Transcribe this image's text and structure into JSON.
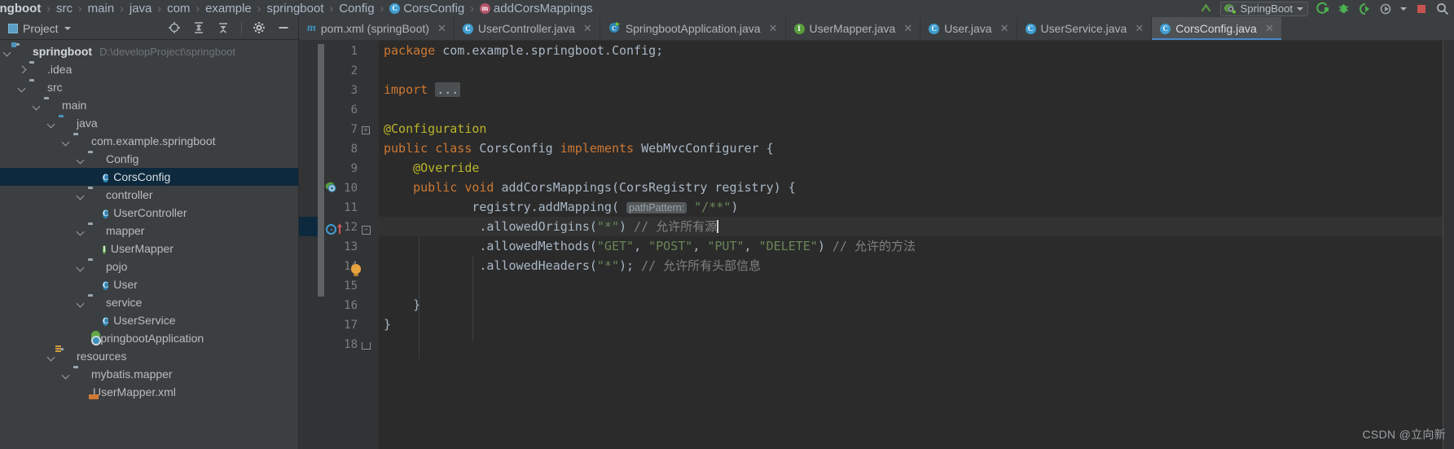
{
  "breadcrumb": {
    "items": [
      {
        "label": "springboot",
        "icon": "none",
        "bold": true
      },
      {
        "label": "src",
        "icon": "none",
        "bold": false
      },
      {
        "label": "main",
        "icon": "none",
        "bold": false
      },
      {
        "label": "java",
        "icon": "none",
        "bold": false
      },
      {
        "label": "com",
        "icon": "none",
        "bold": false
      },
      {
        "label": "example",
        "icon": "none",
        "bold": false
      },
      {
        "label": "springboot",
        "icon": "none",
        "bold": false
      },
      {
        "label": "Config",
        "icon": "none",
        "bold": false
      },
      {
        "label": "CorsConfig",
        "icon": "class-icon",
        "bold": false
      },
      {
        "label": "addCorsMappings",
        "icon": "method-icon",
        "bold": false
      }
    ],
    "separator": "›"
  },
  "toolbar_right": {
    "run_config_label": "SpringBoot",
    "icons": [
      "pointer-icon",
      "run-icon",
      "debug-icon",
      "run-with-coverage-icon",
      "profile-icon",
      "stop-icon",
      "search-icon"
    ]
  },
  "project_panel": {
    "title": "Project",
    "actions": [
      "locate-icon",
      "expand-all-icon",
      "collapse-all-icon",
      "settings-icon",
      "hide-icon"
    ]
  },
  "tabs": [
    {
      "label": "pom.xml (springBoot)",
      "icon": "maven-icon",
      "active": false,
      "closable": true
    },
    {
      "label": "UserController.java",
      "icon": "class-icon",
      "active": false,
      "closable": true
    },
    {
      "label": "SpringbootApplication.java",
      "icon": "spring-class-icon",
      "active": false,
      "closable": true
    },
    {
      "label": "UserMapper.java",
      "icon": "interface-icon",
      "active": false,
      "closable": true
    },
    {
      "label": "User.java",
      "icon": "class-icon",
      "active": false,
      "closable": true
    },
    {
      "label": "UserService.java",
      "icon": "class-icon",
      "active": false,
      "closable": true
    },
    {
      "label": "CorsConfig.java",
      "icon": "class-icon",
      "active": true,
      "closable": true
    }
  ],
  "tree": [
    {
      "label": "springboot",
      "path": "D:\\developProject\\springboot",
      "indent": 0,
      "arrow": "down",
      "icon": "module-folder-icon",
      "bold": true,
      "selected": false
    },
    {
      "label": ".idea",
      "path": "",
      "indent": 1,
      "arrow": "right",
      "icon": "folder-icon",
      "bold": false,
      "selected": false
    },
    {
      "label": "src",
      "path": "",
      "indent": 1,
      "arrow": "down",
      "icon": "folder-icon",
      "bold": false,
      "selected": false
    },
    {
      "label": "main",
      "path": "",
      "indent": 2,
      "arrow": "down",
      "icon": "folder-icon",
      "bold": false,
      "selected": false
    },
    {
      "label": "java",
      "path": "",
      "indent": 3,
      "arrow": "down",
      "icon": "source-folder-icon",
      "bold": false,
      "selected": false
    },
    {
      "label": "com.example.springboot",
      "path": "",
      "indent": 4,
      "arrow": "down",
      "icon": "package-icon",
      "bold": false,
      "selected": false
    },
    {
      "label": "Config",
      "path": "",
      "indent": 5,
      "arrow": "down",
      "icon": "package-icon",
      "bold": false,
      "selected": false
    },
    {
      "label": "CorsConfig",
      "path": "",
      "indent": 6,
      "arrow": "none",
      "icon": "class-icon",
      "bold": false,
      "selected": true
    },
    {
      "label": "controller",
      "path": "",
      "indent": 5,
      "arrow": "down",
      "icon": "package-icon",
      "bold": false,
      "selected": false
    },
    {
      "label": "UserController",
      "path": "",
      "indent": 6,
      "arrow": "none",
      "icon": "class-icon",
      "bold": false,
      "selected": false
    },
    {
      "label": "mapper",
      "path": "",
      "indent": 5,
      "arrow": "down",
      "icon": "package-icon",
      "bold": false,
      "selected": false
    },
    {
      "label": "UserMapper",
      "path": "",
      "indent": 6,
      "arrow": "none",
      "icon": "interface-icon",
      "bold": false,
      "selected": false
    },
    {
      "label": "pojo",
      "path": "",
      "indent": 5,
      "arrow": "down",
      "icon": "package-icon",
      "bold": false,
      "selected": false
    },
    {
      "label": "User",
      "path": "",
      "indent": 6,
      "arrow": "none",
      "icon": "class-icon",
      "bold": false,
      "selected": false
    },
    {
      "label": "service",
      "path": "",
      "indent": 5,
      "arrow": "down",
      "icon": "package-icon",
      "bold": false,
      "selected": false
    },
    {
      "label": "UserService",
      "path": "",
      "indent": 6,
      "arrow": "none",
      "icon": "class-icon",
      "bold": false,
      "selected": false
    },
    {
      "label": "SpringbootApplication",
      "path": "",
      "indent": 5,
      "arrow": "none",
      "icon": "spring-class-icon",
      "bold": false,
      "selected": false
    },
    {
      "label": "resources",
      "path": "",
      "indent": 3,
      "arrow": "down",
      "icon": "resources-folder-icon",
      "bold": false,
      "selected": false
    },
    {
      "label": "mybatis.mapper",
      "path": "",
      "indent": 4,
      "arrow": "down",
      "icon": "folder-icon",
      "bold": false,
      "selected": false
    },
    {
      "label": "UserMapper.xml",
      "path": "",
      "indent": 5,
      "arrow": "none",
      "icon": "xml-icon",
      "bold": false,
      "selected": false
    }
  ],
  "editor": {
    "filename": "CorsConfig.java",
    "line_numbers": [
      "1",
      "2",
      "3",
      "6",
      "7",
      "8",
      "9",
      "10",
      "11",
      "12",
      "13",
      "14",
      "15",
      "16",
      "17",
      "18"
    ],
    "current_line": 12,
    "caret_line": 12,
    "gutter_markers": [
      {
        "line": 8,
        "icon": "spring-bean-icon"
      },
      {
        "line": 10,
        "icon": "overridden-method-icon"
      },
      {
        "line": 10,
        "icon": "annotation-marker-icon"
      },
      {
        "line": 12,
        "icon": "intention-bulb-icon"
      }
    ],
    "lines": [
      {
        "num": "1",
        "tokens": [
          {
            "t": "package ",
            "c": "k"
          },
          {
            "t": "com.example.springboot.Config;",
            "c": "t"
          }
        ]
      },
      {
        "num": "2",
        "tokens": []
      },
      {
        "num": "3",
        "tokens": [
          {
            "t": "import ",
            "c": "k"
          },
          {
            "t": "...",
            "c": "dots"
          }
        ]
      },
      {
        "num": "6",
        "tokens": []
      },
      {
        "num": "7",
        "tokens": [
          {
            "t": "@Configuration",
            "c": "ann"
          }
        ]
      },
      {
        "num": "8",
        "tokens": [
          {
            "t": "public class ",
            "c": "k"
          },
          {
            "t": "CorsConfig ",
            "c": "t"
          },
          {
            "t": "implements ",
            "c": "k"
          },
          {
            "t": "WebMvcConfigurer {",
            "c": "t"
          }
        ]
      },
      {
        "num": "9",
        "tokens": [
          {
            "t": "    @Override",
            "c": "ann"
          }
        ]
      },
      {
        "num": "10",
        "tokens": [
          {
            "t": "    public void ",
            "c": "k"
          },
          {
            "t": "addCorsMappings(CorsRegistry registry) {",
            "c": "t"
          }
        ]
      },
      {
        "num": "11",
        "tokens": [
          {
            "t": "            registry.addMapping( ",
            "c": "t"
          },
          {
            "t": "pathPattern:",
            "c": "hint"
          },
          {
            "t": " ",
            "c": "t"
          },
          {
            "t": "\"/**\"",
            "c": "s"
          },
          {
            "t": ")",
            "c": "t"
          }
        ]
      },
      {
        "num": "12",
        "tokens": [
          {
            "t": "             .allowedOrigins(",
            "c": "t"
          },
          {
            "t": "\"*\"",
            "c": "s"
          },
          {
            "t": ") ",
            "c": "t"
          },
          {
            "t": "// 允许所有源",
            "c": "c"
          }
        ]
      },
      {
        "num": "13",
        "tokens": [
          {
            "t": "             .allowedMethods(",
            "c": "t"
          },
          {
            "t": "\"GET\"",
            "c": "s"
          },
          {
            "t": ", ",
            "c": "t"
          },
          {
            "t": "\"POST\"",
            "c": "s"
          },
          {
            "t": ", ",
            "c": "t"
          },
          {
            "t": "\"PUT\"",
            "c": "s"
          },
          {
            "t": ", ",
            "c": "t"
          },
          {
            "t": "\"DELETE\"",
            "c": "s"
          },
          {
            "t": ") ",
            "c": "t"
          },
          {
            "t": "// 允许的方法",
            "c": "c"
          }
        ]
      },
      {
        "num": "14",
        "tokens": [
          {
            "t": "             .allowedHeaders(",
            "c": "t"
          },
          {
            "t": "\"*\"",
            "c": "s"
          },
          {
            "t": "); ",
            "c": "t"
          },
          {
            "t": "// 允许所有头部信息",
            "c": "c"
          }
        ]
      },
      {
        "num": "15",
        "tokens": []
      },
      {
        "num": "16",
        "tokens": [
          {
            "t": "    }",
            "c": "t"
          }
        ]
      },
      {
        "num": "17",
        "tokens": [
          {
            "t": "}",
            "c": "t"
          }
        ]
      },
      {
        "num": "18",
        "tokens": []
      }
    ]
  },
  "watermark": "CSDN @立向新",
  "colors": {
    "background": "#3c3f41",
    "editor_background": "#2b2b2b",
    "selection": "#0d293e",
    "accent": "#4a88c7",
    "keyword": "#cc7832",
    "string": "#6a8759",
    "annotation": "#bbb529",
    "comment": "#808080",
    "text": "#a9b7c6"
  }
}
